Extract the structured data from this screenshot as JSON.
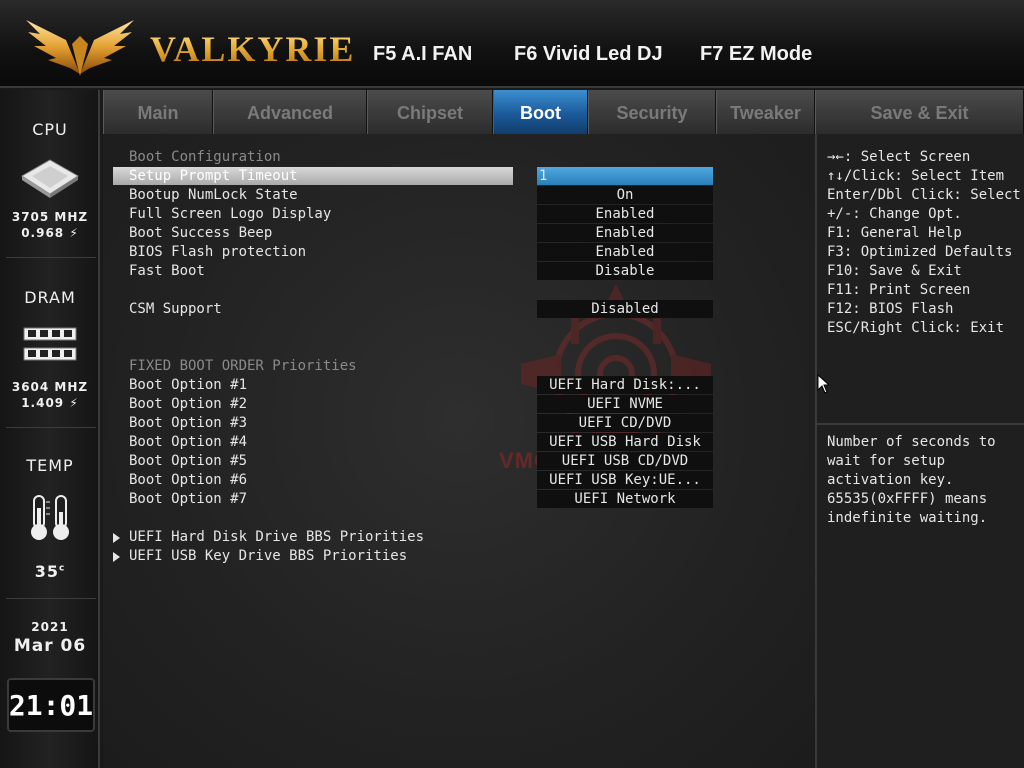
{
  "header": {
    "brand": "VALKYRIE",
    "hotkeys": [
      {
        "label": "F5 A.I FAN"
      },
      {
        "label": "F6 Vivid Led DJ"
      },
      {
        "label": "F7 EZ Mode"
      }
    ]
  },
  "sidebar": {
    "cpu": {
      "title": "CPU",
      "freq": "3705 MHZ",
      "volt": "0.968"
    },
    "dram": {
      "title": "DRAM",
      "freq": "3604 MHZ",
      "volt": "1.409"
    },
    "temp": {
      "title": "TEMP",
      "value": "35",
      "unit": "c"
    },
    "date": {
      "year": "2021",
      "monthday": "Mar 06"
    },
    "time": "21:01"
  },
  "tabs": [
    {
      "label": "Main"
    },
    {
      "label": "Advanced"
    },
    {
      "label": "Chipset"
    },
    {
      "label": "Boot",
      "active": true
    },
    {
      "label": "Security"
    },
    {
      "label": "Tweaker"
    },
    {
      "label": "Save & Exit"
    }
  ],
  "boot": {
    "section_config": "Boot Configuration",
    "settings": [
      {
        "label": "Setup Prompt Timeout",
        "value": "1",
        "selected": true
      },
      {
        "label": "Bootup NumLock State",
        "value": "On"
      },
      {
        "label": "Full Screen Logo Display",
        "value": "Enabled"
      },
      {
        "label": "Boot Success Beep",
        "value": "Enabled"
      },
      {
        "label": "BIOS Flash protection",
        "value": "Enabled"
      },
      {
        "label": "Fast Boot",
        "value": "Disable"
      }
    ],
    "csm": {
      "label": "CSM Support",
      "value": "Disabled"
    },
    "section_order": "FIXED BOOT ORDER Priorities",
    "options": [
      {
        "label": "Boot Option #1",
        "value": "UEFI Hard Disk:..."
      },
      {
        "label": "Boot Option #2",
        "value": "UEFI NVME"
      },
      {
        "label": "Boot Option #3",
        "value": "UEFI CD/DVD"
      },
      {
        "label": "Boot Option #4",
        "value": "UEFI USB Hard Disk"
      },
      {
        "label": "Boot Option #5",
        "value": "UEFI USB CD/DVD"
      },
      {
        "label": "Boot Option #6",
        "value": "UEFI USB Key:UE..."
      },
      {
        "label": "Boot Option #7",
        "value": "UEFI Network"
      }
    ],
    "submenus": [
      {
        "label": "UEFI Hard Disk Drive BBS Priorities"
      },
      {
        "label": "UEFI USB Key Drive BBS Priorities"
      }
    ],
    "watermark": "VMODTECH.COM"
  },
  "help": {
    "keys": [
      "→←: Select Screen",
      "↑↓/Click: Select Item",
      "Enter/Dbl Click: Select",
      "+/-: Change Opt.",
      "F1: General Help",
      "F3: Optimized Defaults",
      "F10: Save & Exit",
      "F11: Print Screen",
      "F12: BIOS Flash",
      "ESC/Right Click: Exit"
    ],
    "description": [
      "Number of seconds to",
      "wait for setup",
      "activation key.",
      "65535(0xFFFF) means",
      "indefinite waiting."
    ]
  }
}
